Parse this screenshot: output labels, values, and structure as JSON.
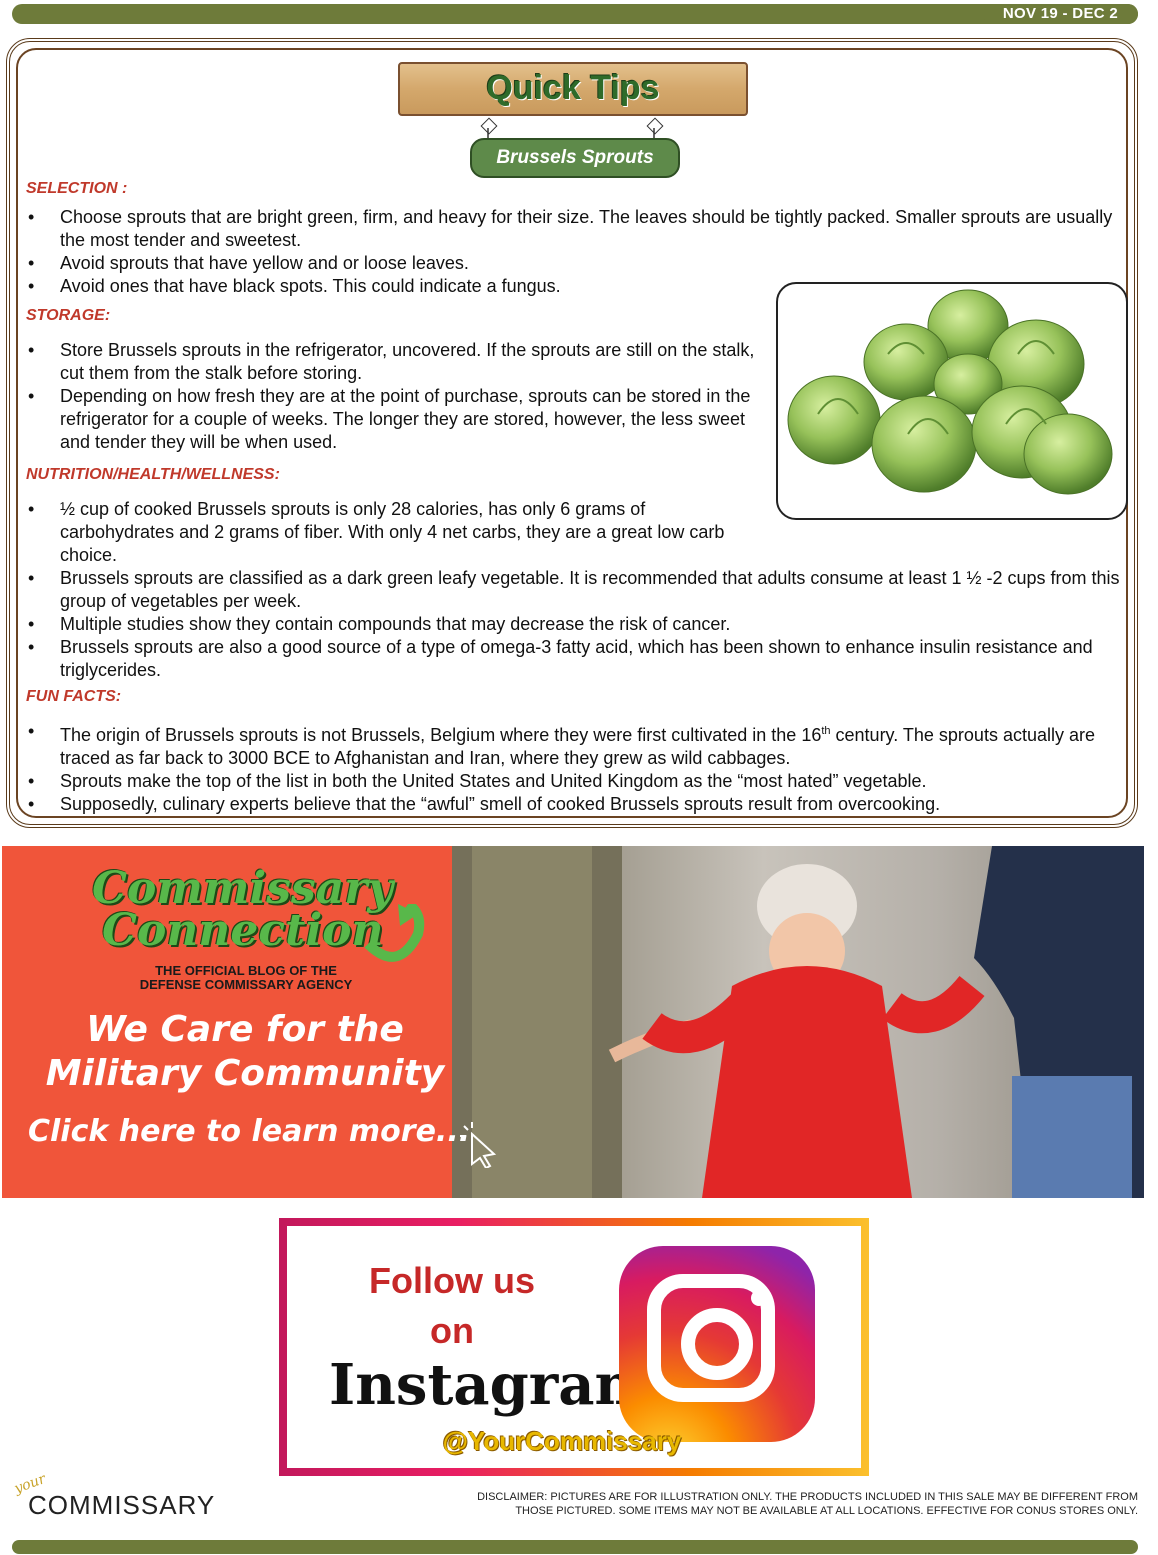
{
  "header": {
    "date_range": "NOV 19 - DEC 2"
  },
  "sign": {
    "title": "Quick Tips",
    "subtitle": "Brussels Sprouts"
  },
  "sections": {
    "selection": {
      "heading": "SELECTION :",
      "items": [
        "Choose sprouts that are bright green, firm, and heavy for their size.  The leaves should be tightly packed.  Smaller sprouts are usually the most tender and sweetest.",
        "Avoid sprouts that have yellow and or loose leaves.",
        "Avoid ones that have black spots.  This could indicate a fungus."
      ]
    },
    "storage": {
      "heading": "STORAGE:",
      "items": [
        "Store Brussels sprouts in the refrigerator, uncovered.  If the sprouts are still on the stalk, cut them from the stalk before storing.",
        "Depending on how fresh they are at the point of purchase, sprouts can be stored in the refrigerator for a couple of weeks.  The longer they are stored, however, the less sweet and tender they will be when used."
      ]
    },
    "nutrition": {
      "heading": "NUTRITION/HEALTH/WELLNESS:",
      "items": [
        "½ cup of cooked Brussels sprouts is only 28 calories, has only 6 grams of carbohydrates and 2 grams of fiber.  With only 4 net carbs, they are a great low carb choice.",
        "Brussels sprouts are classified as a dark green leafy vegetable.  It is recommended that adults consume at least 1 ½ -2 cups from this group of vegetables per week.",
        "Multiple studies show they contain compounds that may decrease the risk of cancer.",
        "Brussels sprouts are also a good source of a type of omega-3 fatty acid, which has been shown to enhance insulin resistance and triglycerides."
      ]
    },
    "fun_facts": {
      "heading": "FUN FACTS:",
      "item1_before": "The origin of Brussels sprouts is not Brussels, Belgium where they were first cultivated in the 16",
      "item1_sup": "th",
      "item1_after": " century.  The sprouts actually are traced as far back to 3000 BCE to Afghanistan and Iran, where they grew as wild cabbages.",
      "items_rest": [
        "Sprouts make the top of the list in both the United States and United Kingdom as the “most hated” vegetable.",
        "Supposedly, culinary experts believe that the “awful” smell of cooked Brussels sprouts  result from overcooking."
      ]
    }
  },
  "banner": {
    "logo_line1": "Commissary",
    "logo_line2": "Connection",
    "blog_line1": "THE OFFICIAL BLOG OF THE",
    "blog_line2": "DEFENSE COMMISSARY AGENCY",
    "care_line1": "We Care for the",
    "care_line2": "Military Community",
    "cta": "Click here to learn more..."
  },
  "instagram": {
    "follow_line1": "Follow us",
    "follow_line2": "on",
    "word": "Instagram",
    "handle": "@YourCommissary"
  },
  "footer": {
    "logo_script": "your",
    "logo_word": "COMMISSARY",
    "disclaimer_line1": "DISCLAIMER: PICTURES ARE FOR ILLUSTRATION ONLY. THE PRODUCTS INCLUDED IN THIS SALE MAY BE DIFFERENT FROM",
    "disclaimer_line2": "THOSE PICTURED. SOME ITEMS MAY NOT BE AVAILABLE AT ALL LOCATIONS. EFFECTIVE FOR CONUS STORES ONLY."
  },
  "colors": {
    "bar": "#6e7b3a",
    "section_heading": "#c0392b",
    "banner": "#f0553a",
    "sign_text": "#2f6b2a"
  }
}
